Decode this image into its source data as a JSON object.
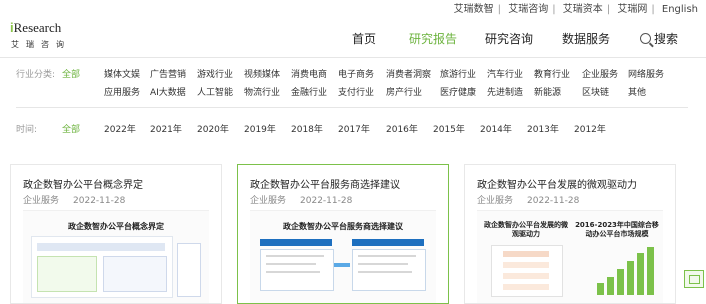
{
  "top_links": [
    "艾瑞数智",
    "艾瑞咨询",
    "艾瑞资本",
    "艾瑞网",
    "English"
  ],
  "logo": {
    "mark_i": "i",
    "mark_text": "Research",
    "sub": "艾瑞咨询"
  },
  "nav": {
    "items": [
      {
        "label": "首页",
        "active": false
      },
      {
        "label": "研究报告",
        "active": true
      },
      {
        "label": "研究咨询",
        "active": false
      },
      {
        "label": "数据服务",
        "active": false
      }
    ],
    "search_label": "搜索"
  },
  "filters": {
    "industry_label": "行业分类:",
    "industry_row1": [
      "全部",
      "媒体文娱",
      "广告营销",
      "游戏行业",
      "视频媒体",
      "消费电商",
      "电子商务",
      "消费者洞察",
      "旅游行业",
      "汽车行业",
      "教育行业",
      "企业服务",
      "网络服务"
    ],
    "industry_row2": [
      "应用服务",
      "AI大数据",
      "人工智能",
      "物流行业",
      "金融行业",
      "支付行业",
      "房产行业",
      "医疗健康",
      "先进制造",
      "新能源",
      "区块链",
      "其他"
    ],
    "time_label": "时间:",
    "time_options": [
      "全部",
      "2022年",
      "2021年",
      "2020年",
      "2019年",
      "2018年",
      "2017年",
      "2016年",
      "2015年",
      "2014年",
      "2013年",
      "2012年"
    ]
  },
  "cards": [
    {
      "title": "政企数智办公平台概念界定",
      "category": "企业服务",
      "date": "2022-11-28",
      "thumb_title": "政企数智办公平台概念界定"
    },
    {
      "title": "政企数智办公平台服务商选择建议",
      "category": "企业服务",
      "date": "2022-11-28",
      "thumb_title": "政企数智办公平台服务商选择建议"
    },
    {
      "title": "政企数智办公平台发展的微观驱动力",
      "category": "企业服务",
      "date": "2022-11-28",
      "thumb_title": "政企数智办公平台发展的微观驱动力",
      "thumb_title_2": "2016-2023年中国综合移动办公平台市场规模"
    }
  ],
  "colors": {
    "accent": "#6cb33e",
    "border_highlight": "#7cc14a"
  }
}
